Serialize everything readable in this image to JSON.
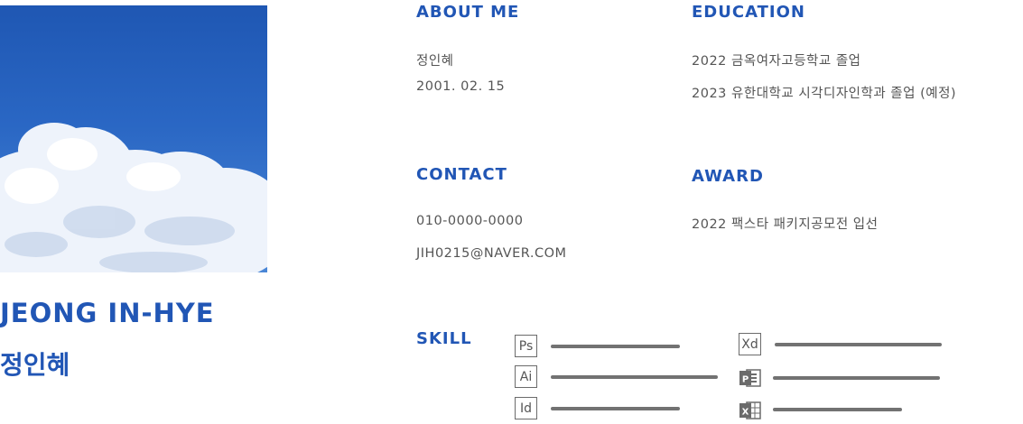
{
  "profile": {
    "photo_icon": "sky-clouds-photo",
    "name_en": "JEONG IN-HYE",
    "name_ko": "정인혜"
  },
  "about": {
    "title": "ABOUT ME",
    "name": "정인혜",
    "birth": "2001. 02. 15"
  },
  "education": {
    "title": "EDUCATION",
    "items": [
      "2022 금옥여자고등학교 졸업",
      "2023 유한대학교 시각디자인학과 졸업 (예정)"
    ]
  },
  "contact": {
    "title": "CONTACT",
    "phone": "010-0000-0000",
    "email": "JIH0215@NAVER.COM"
  },
  "award": {
    "title": "AWARD",
    "items": [
      "2022 팩스타 패키지공모전 입선"
    ]
  },
  "skill": {
    "title": "SKILL",
    "items": [
      {
        "label": "Ps",
        "icon": "photoshop-icon",
        "level": 0.68
      },
      {
        "label": "Ai",
        "icon": "illustrator-icon",
        "level": 0.88
      },
      {
        "label": "Id",
        "icon": "indesign-icon",
        "level": 0.68
      },
      {
        "label": "Xd",
        "icon": "xd-icon",
        "level": 0.88
      },
      {
        "label": "",
        "icon": "powerpoint-icon",
        "level": 0.88
      },
      {
        "label": "",
        "icon": "excel-icon",
        "level": 0.68
      }
    ]
  },
  "colors": {
    "accent": "#2156b5",
    "text": "#555555",
    "bar": "#727272"
  }
}
